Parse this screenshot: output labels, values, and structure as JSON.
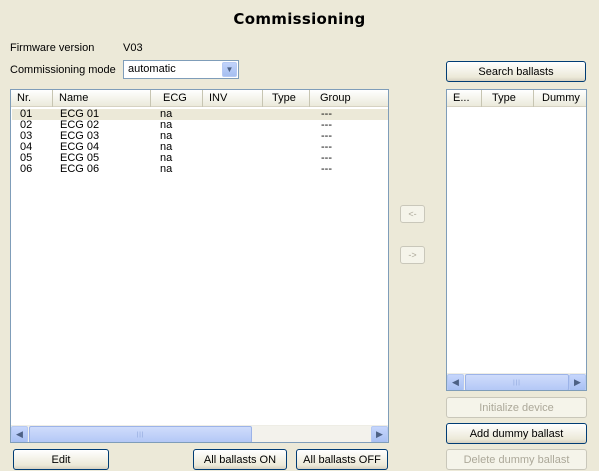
{
  "title": "Commissioning",
  "firmware": {
    "label": "Firmware version",
    "value": "V03"
  },
  "mode": {
    "label": "Commissioning mode",
    "selected": "automatic"
  },
  "ballast_list": {
    "columns": [
      "Nr.",
      "Name",
      "ECG",
      "INV",
      "Type",
      "Group"
    ],
    "rows": [
      {
        "nr": "01",
        "name": "ECG 01",
        "ecg": "na",
        "inv": "",
        "type": "",
        "group": "---"
      },
      {
        "nr": "02",
        "name": "ECG 02",
        "ecg": "na",
        "inv": "",
        "type": "",
        "group": "---"
      },
      {
        "nr": "03",
        "name": "ECG 03",
        "ecg": "na",
        "inv": "",
        "type": "",
        "group": "---"
      },
      {
        "nr": "04",
        "name": "ECG 04",
        "ecg": "na",
        "inv": "",
        "type": "",
        "group": "---"
      },
      {
        "nr": "05",
        "name": "ECG 05",
        "ecg": "na",
        "inv": "",
        "type": "",
        "group": "---"
      },
      {
        "nr": "06",
        "name": "ECG 06",
        "ecg": "na",
        "inv": "",
        "type": "",
        "group": "---"
      }
    ]
  },
  "found_list": {
    "columns": [
      "E...",
      "Type",
      "Dummy"
    ]
  },
  "buttons": {
    "search": "Search ballasts",
    "move_left": "<-",
    "move_right": "->",
    "edit": "Edit",
    "all_on": "All ballasts ON",
    "all_off": "All ballasts OFF",
    "initialize": "Initialize device",
    "add_dummy": "Add dummy ballast",
    "delete_dummy": "Delete dummy ballast"
  },
  "icons": {
    "dropdown": "chevron-down-icon",
    "scroll_left": "scroll-left-icon",
    "scroll_right": "scroll-right-icon"
  },
  "colors": {
    "window_bg": "#ece9d8",
    "border": "#7f9db9",
    "button_border": "#003c74"
  }
}
